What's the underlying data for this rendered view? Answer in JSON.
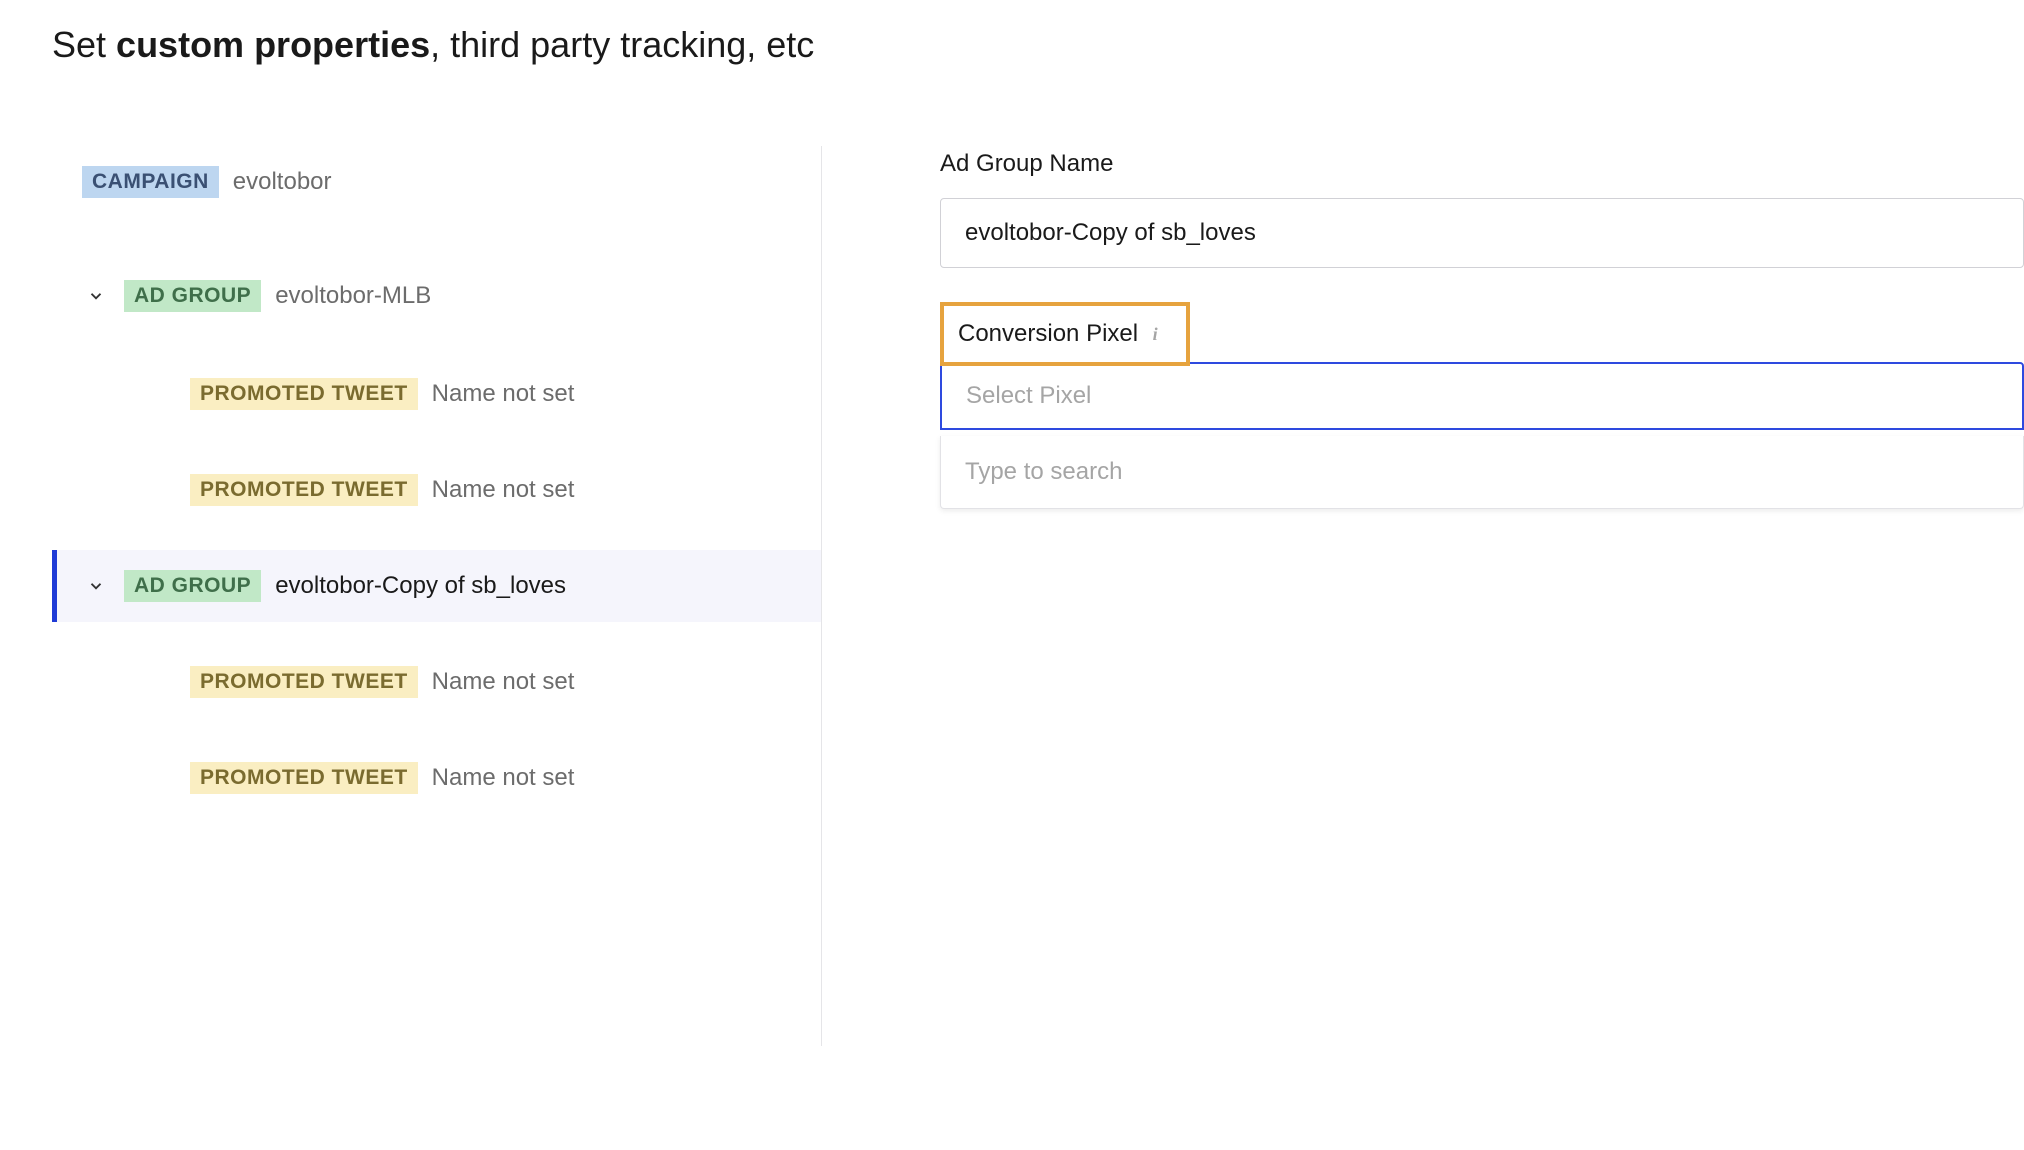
{
  "header": {
    "prefix": "Set ",
    "bold": "custom properties",
    "suffix": ", third party tracking, etc"
  },
  "sidebar": {
    "campaign": {
      "badge": "CAMPAIGN",
      "name": "evoltobor"
    },
    "adgroups": [
      {
        "badge": "AD GROUP",
        "name": "evoltobor-MLB",
        "selected": false,
        "tweets": [
          {
            "badge": "PROMOTED TWEET",
            "name": "Name not set"
          },
          {
            "badge": "PROMOTED TWEET",
            "name": "Name not set"
          }
        ]
      },
      {
        "badge": "AD GROUP",
        "name": "evoltobor-Copy of sb_loves",
        "selected": true,
        "tweets": [
          {
            "badge": "PROMOTED TWEET",
            "name": "Name not set"
          },
          {
            "badge": "PROMOTED TWEET",
            "name": "Name not set"
          }
        ]
      }
    ]
  },
  "main": {
    "adGroupName": {
      "label": "Ad Group Name",
      "value": "evoltobor-Copy of sb_loves"
    },
    "conversionPixel": {
      "label": "Conversion Pixel",
      "placeholder": "Select Pixel",
      "searchPlaceholder": "Type to search"
    }
  }
}
